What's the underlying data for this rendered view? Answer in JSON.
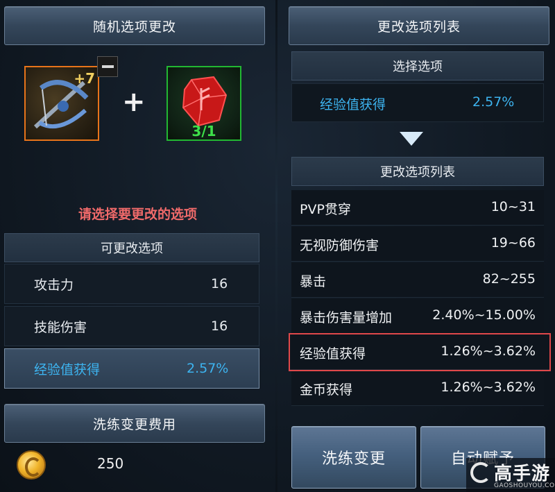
{
  "left_panel": {
    "title": "随机选项更改",
    "weapon": {
      "enhance": "+7"
    },
    "gem": {
      "count": "3/1"
    },
    "prompt": "请选择要更改的选项",
    "options_title": "可更改选项",
    "options": [
      {
        "label": "攻击力",
        "value": "16"
      },
      {
        "label": "技能伤害",
        "value": "16"
      },
      {
        "label": "经验值获得",
        "value": "2.57%",
        "selected": true
      }
    ],
    "cost_title": "洗练变更费用",
    "cost_value": "250"
  },
  "right_panel": {
    "title": "更改选项列表",
    "selected_title": "选择选项",
    "selected_option": {
      "label": "经验值获得",
      "value": "2.57%"
    },
    "list_title": "更改选项列表",
    "list": [
      {
        "label": "PVP贯穿",
        "value": "10~31"
      },
      {
        "label": "无视防御伤害",
        "value": "19~66"
      },
      {
        "label": "暴击",
        "value": "82~255"
      },
      {
        "label": "暴击伤害量增加",
        "value": "2.40%~15.00%"
      },
      {
        "label": "经验值获得",
        "value": "1.26%~3.62%",
        "highlighted": true
      },
      {
        "label": "金币获得",
        "value": "1.26%~3.62%"
      }
    ],
    "buttons": {
      "refine": "洗练变更",
      "auto": "自动赋予"
    }
  },
  "watermark": {
    "text": "高手游",
    "sub": "GAOSHOUYOU.COM"
  },
  "colors": {
    "accent_blue": "#3db4f0",
    "prompt_red": "#f06a6a",
    "highlight_border": "#e0484a",
    "weapon_border": "#e8741a",
    "gem_border": "#22b832"
  }
}
